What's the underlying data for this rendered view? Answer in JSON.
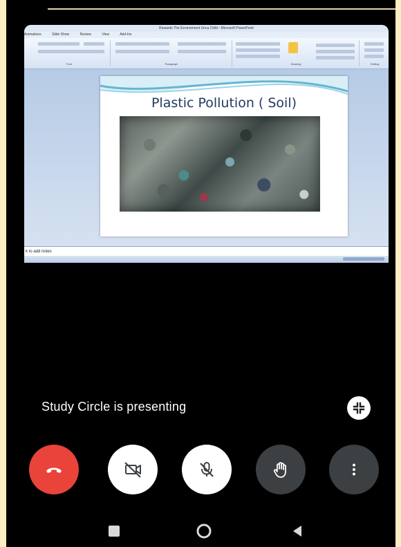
{
  "shared_screen": {
    "window_title": "Rewards The Environment Unca Child - Microsoft PowerPoint",
    "menu_tabs": [
      "Animations",
      "Slide Show",
      "Review",
      "View",
      "Add-Ins"
    ],
    "ribbon_groups": [
      "Font",
      "Paragraph",
      "Drawing",
      "Editing"
    ],
    "slide_title": "Plastic Pollution ( Soil)",
    "notes_placeholder": "k to add notes"
  },
  "presenter": {
    "status_text": "Study Circle is presenting"
  },
  "icons": {
    "minimize": "minimize-screen-icon",
    "end_call": "phone-hangup-icon",
    "camera": "camera-off-icon",
    "mic": "mic-off-icon",
    "hand": "raise-hand-icon",
    "more": "more-vertical-icon",
    "recents": "nav-square-icon",
    "home": "nav-home-circle-icon",
    "back": "nav-back-triangle-icon"
  },
  "colors": {
    "end_call": "#e9433a",
    "control_dark": "#3c4043",
    "control_light": "#ffffff",
    "page_border": "#fbeec2"
  }
}
